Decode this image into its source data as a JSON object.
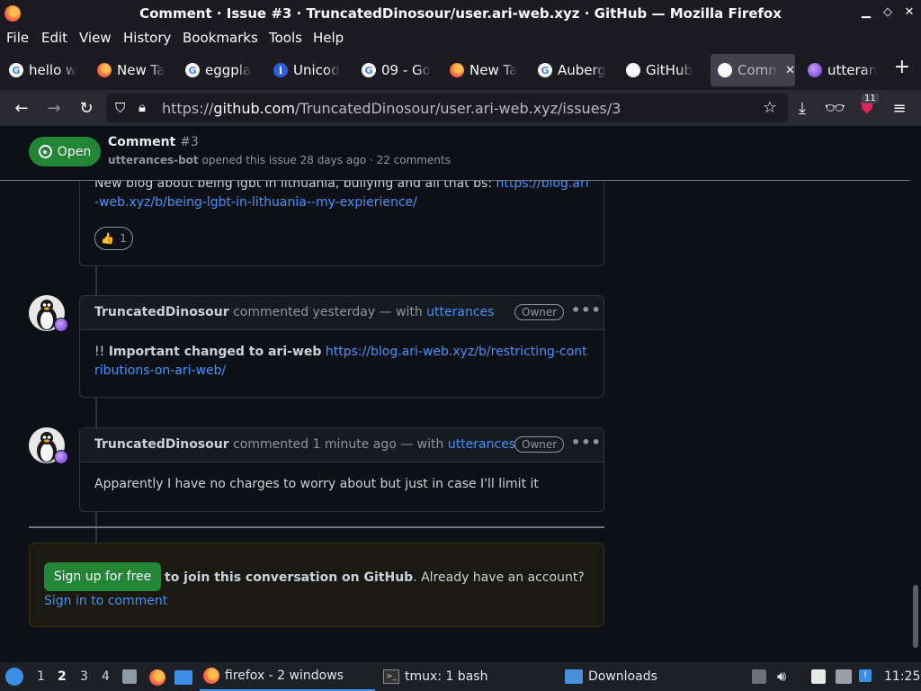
{
  "window": {
    "title": "Comment · Issue #3 · TruncatedDinosour/user.ari-web.xyz · GitHub — Mozilla Firefox"
  },
  "menu": [
    "File",
    "Edit",
    "View",
    "History",
    "Bookmarks",
    "Tools",
    "Help"
  ],
  "tabs": [
    {
      "label": "hello w",
      "icon": "google-icon"
    },
    {
      "label": "New Ta",
      "icon": "firefox-icon"
    },
    {
      "label": "eggpla",
      "icon": "google-icon"
    },
    {
      "label": "Unicod",
      "icon": "info-icon"
    },
    {
      "label": "09 - Go",
      "icon": "google-icon"
    },
    {
      "label": "New Ta",
      "icon": "firefox-icon"
    },
    {
      "label": "Auberg",
      "icon": "google-icon"
    },
    {
      "label": "GitHub",
      "icon": "github-icon"
    },
    {
      "label": "Comm",
      "icon": "github-icon",
      "active": true
    },
    {
      "label": "utteran",
      "icon": "utterances-icon"
    }
  ],
  "url": {
    "host_prefix": "https://",
    "host": "github.com",
    "path": "/TruncatedDinosour/user.ari-web.xyz/issues/3"
  },
  "extension_badge": "11",
  "issue": {
    "state": "Open",
    "title": "Comment",
    "number": "#3",
    "author": "utterances-bot",
    "meta": "opened this issue 28 days ago · 22 comments"
  },
  "comments": [
    {
      "body_text": "New blog about being lgbt in lithuania, bullying and all that bs: ",
      "link": "https://blog.ari-web.xyz/b/being-lgbt-in-lithuania--my-expierience/",
      "reaction_emoji": "👍",
      "reaction_count": "1"
    },
    {
      "author": "TruncatedDinosour",
      "action": "commented yesterday — with",
      "via": "utterances",
      "badge": "Owner",
      "body_prefix": "!! ",
      "body_bold": "Important changed to ari-web",
      "link": "https://blog.ari-web.xyz/b/restricting-contributions-on-ari-web/"
    },
    {
      "author": "TruncatedDinosour",
      "action": "commented 1 minute ago — with",
      "via": "utterances",
      "badge": "Owner",
      "body": "Apparently I have no charges to worry about but just in case I'll limit it"
    }
  ],
  "signup": {
    "button": "Sign up for free",
    "bold": "to join this conversation on GitHub",
    "text": ". Already have an account? ",
    "link": "Sign in to comment"
  },
  "taskbar": {
    "workspaces": [
      "1",
      "2",
      "3",
      "4"
    ],
    "current_workspace": "2",
    "tasks": [
      {
        "label": "firefox - 2 windows",
        "icon": "firefox-icon"
      },
      {
        "label": "tmux: 1 bash",
        "icon": "terminal-icon"
      },
      {
        "label": "Downloads",
        "icon": "folder-icon"
      }
    ],
    "clock": "11:25"
  }
}
